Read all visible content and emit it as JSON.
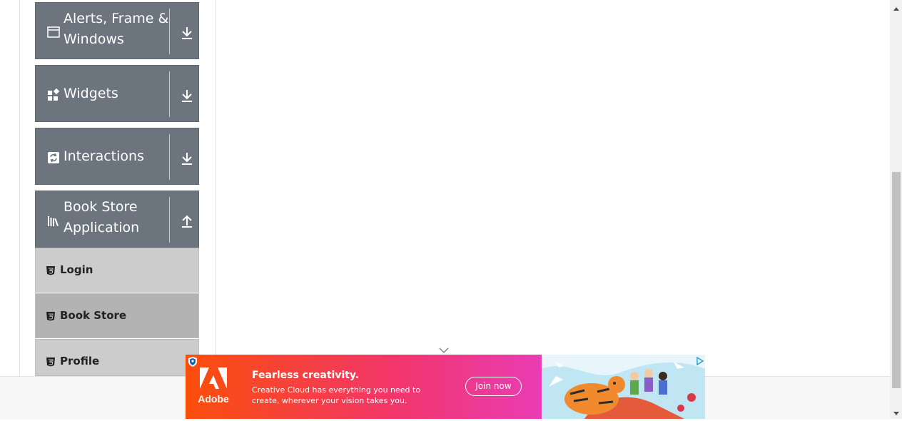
{
  "colors": {
    "group_header_bg": "#6c757d",
    "sub_item_bg": "#cccccc",
    "sub_item_active_bg": "#b3b3b3",
    "ad_gradient_start": "#fa4e0a",
    "ad_gradient_end": "#f046d8"
  },
  "sidebar": {
    "groups": [
      {
        "title": "Alerts, Frame & Windows",
        "icon": "window-icon",
        "expanded": false,
        "arrow": "download-arrow-icon"
      },
      {
        "title": "Widgets",
        "icon": "widgets-icon",
        "expanded": false,
        "arrow": "download-arrow-icon"
      },
      {
        "title": "Interactions",
        "icon": "interactions-icon",
        "expanded": false,
        "arrow": "download-arrow-icon"
      },
      {
        "title": "Book Store Application",
        "icon": "books-icon",
        "expanded": true,
        "arrow": "upload-arrow-icon"
      }
    ],
    "book_store_items": [
      {
        "label": "Login",
        "icon": "html5-icon",
        "active": false
      },
      {
        "label": "Book Store",
        "icon": "html5-icon",
        "active": true
      },
      {
        "label": "Profile",
        "icon": "html5-icon",
        "active": false
      }
    ]
  },
  "ad": {
    "brand": "Adobe",
    "headline": "Fearless creativity.",
    "body": "Creative Cloud has everything you need to create, wherever your vision takes you.",
    "cta": "Join now"
  }
}
